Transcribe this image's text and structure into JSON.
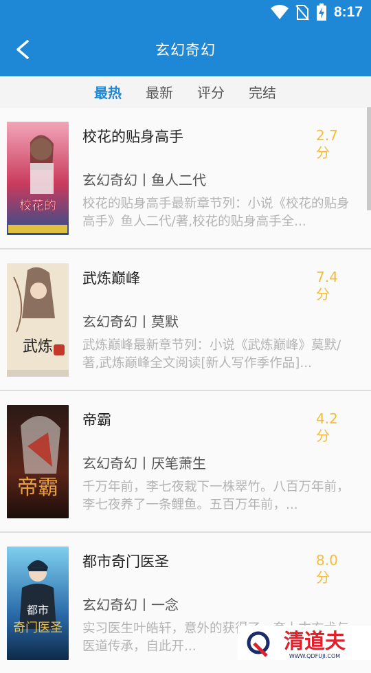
{
  "status_bar": {
    "time": "8:17",
    "icons": [
      "wifi-icon",
      "no-sim-icon",
      "battery-charging-icon"
    ]
  },
  "header": {
    "title": "玄幻奇幻",
    "back_icon": "back-arrow-icon"
  },
  "tabs": [
    {
      "label": "最热",
      "active": true
    },
    {
      "label": "最新",
      "active": false
    },
    {
      "label": "评分",
      "active": false
    },
    {
      "label": "完结",
      "active": false
    }
  ],
  "books": [
    {
      "title": "校花的贴身高手",
      "score": "2.7",
      "score_unit": "分",
      "meta": "玄幻奇幻丨鱼人二代",
      "desc": "校花的贴身高手最新章节列：小说《校花的贴身高手》鱼人二代/著,校花的贴身高手全..."
    },
    {
      "title": "武炼巅峰",
      "score": "7.4",
      "score_unit": "分",
      "meta": "玄幻奇幻丨莫默",
      "desc": "武炼巅峰最新章节列：小说《武炼巅峰》莫默/著,武炼巅峰全文阅读[新人写作季作品]..."
    },
    {
      "title": "帝霸",
      "score": "4.2",
      "score_unit": "分",
      "meta": "玄幻奇幻丨厌笔萧生",
      "desc": "千万年前，李七夜栽下一株翠竹。八百万年前，李七夜养了一条鲤鱼。五百万年前，..."
    },
    {
      "title": "都市奇门医圣",
      "score": "8.0",
      "score_unit": "分",
      "meta": "玄幻奇幻丨一念",
      "desc": "实习医生叶皓轩，意外的获得了一套上古玄术与医道传承，自此开..."
    }
  ],
  "covers": [
    {
      "text": "校花的贴身高手",
      "colors": [
        "#e85a7a",
        "#2a4f8f"
      ]
    },
    {
      "text": "武炼巅峰",
      "colors": [
        "#efe4cf",
        "#8a2a1a"
      ]
    },
    {
      "text": "帝霸",
      "colors": [
        "#3a1a14",
        "#c0391f"
      ]
    },
    {
      "text": "都市奇门医圣",
      "colors": [
        "#2a6aa8",
        "#e8c050"
      ]
    }
  ],
  "watermark": {
    "brand": "清道夫",
    "url": "WWW.QDFUJI.COM"
  },
  "colors": {
    "primary": "#1e88d6",
    "score": "#f5bc3a"
  }
}
